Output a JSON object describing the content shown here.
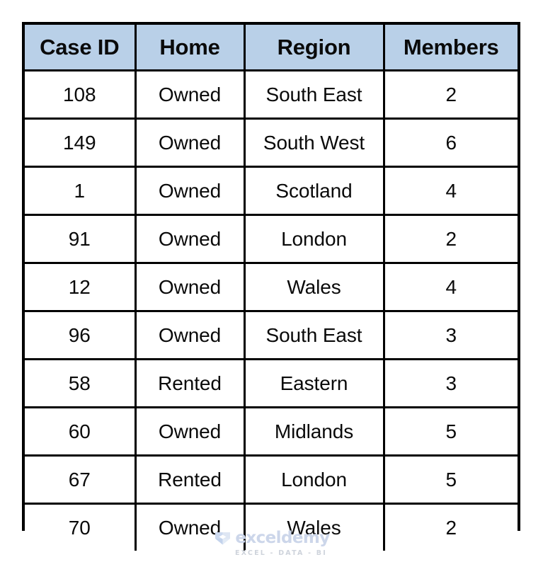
{
  "table": {
    "name": "household-dataset-table",
    "header_background": "#b9d0e8",
    "border_color": "#000000",
    "columns": [
      {
        "key": "case_id",
        "label": "Case ID"
      },
      {
        "key": "home",
        "label": "Home"
      },
      {
        "key": "region",
        "label": "Region"
      },
      {
        "key": "members",
        "label": "Members"
      }
    ],
    "rows": [
      {
        "case_id": "108",
        "home": "Owned",
        "region": "South East",
        "members": "2"
      },
      {
        "case_id": "149",
        "home": "Owned",
        "region": "South West",
        "members": "6"
      },
      {
        "case_id": "1",
        "home": "Owned",
        "region": "Scotland",
        "members": "4"
      },
      {
        "case_id": "91",
        "home": "Owned",
        "region": "London",
        "members": "2"
      },
      {
        "case_id": "12",
        "home": "Owned",
        "region": "Wales",
        "members": "4"
      },
      {
        "case_id": "96",
        "home": "Owned",
        "region": "South East",
        "members": "3"
      },
      {
        "case_id": "58",
        "home": "Rented",
        "region": "Eastern",
        "members": "3"
      },
      {
        "case_id": "60",
        "home": "Owned",
        "region": "Midlands",
        "members": "5"
      },
      {
        "case_id": "67",
        "home": "Rented",
        "region": "London",
        "members": "5"
      },
      {
        "case_id": "70",
        "home": "Owned",
        "region": "Wales",
        "members": "2"
      }
    ]
  },
  "watermark": {
    "icon": "exceldemy-cube-logo-icon",
    "word": "exceldemy",
    "tagline": "EXCEL - DATA - BI",
    "color": "#ccd6ea"
  }
}
